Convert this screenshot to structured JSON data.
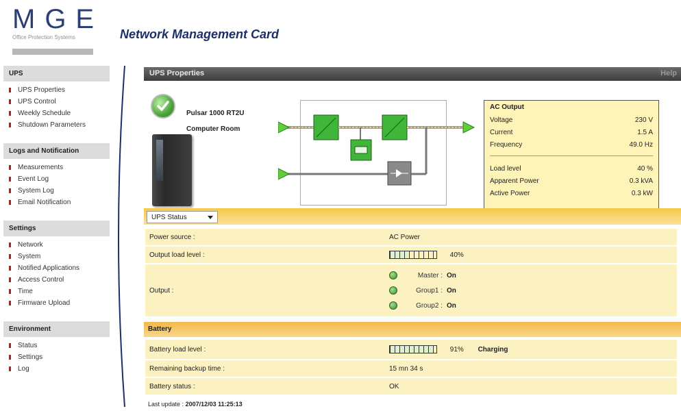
{
  "header": {
    "logo": "MGE",
    "logo_sub": "Office Protection Systems",
    "app_title": "Network Management Card"
  },
  "sidebar": {
    "sections": [
      {
        "title": "UPS",
        "items": [
          "UPS Properties",
          "UPS Control",
          "Weekly Schedule",
          "Shutdown Parameters"
        ]
      },
      {
        "title": "Logs and Notification",
        "items": [
          "Measurements",
          "Event Log",
          "System Log",
          "Email Notification"
        ]
      },
      {
        "title": "Settings",
        "items": [
          "Network",
          "System",
          "Notified Applications",
          "Access Control",
          "Time",
          "Firmware Upload"
        ]
      },
      {
        "title": "Environment",
        "items": [
          "Status",
          "Settings",
          "Log"
        ]
      }
    ]
  },
  "props": {
    "title": "UPS Properties",
    "help": "Help",
    "model": "Pulsar 1000 RT2U",
    "location": "Computer Room"
  },
  "ac_output": {
    "title": "AC Output",
    "rows1": [
      {
        "label": "Voltage",
        "value": "230 V"
      },
      {
        "label": "Current",
        "value": "1.5 A"
      },
      {
        "label": "Frequency",
        "value": "49.0 Hz"
      }
    ],
    "rows2": [
      {
        "label": "Load level",
        "value": "40 %"
      },
      {
        "label": "Apparent Power",
        "value": "0.3 kVA"
      },
      {
        "label": "Active Power",
        "value": "0.3 kW"
      }
    ]
  },
  "status": {
    "select_value": "UPS Status",
    "power_source_label": "Power source :",
    "power_source_value": "AC Power",
    "output_load_label": "Output load level :",
    "output_load_pct": "40%",
    "output_load_fraction": 0.4,
    "output_label": "Output :",
    "outputs": [
      {
        "name": "Master :",
        "state": "On"
      },
      {
        "name": "Group1 :",
        "state": "On"
      },
      {
        "name": "Group2 :",
        "state": "On"
      }
    ]
  },
  "battery": {
    "header": "Battery",
    "load_label": "Battery load level :",
    "load_pct": "91%",
    "load_fraction": 0.91,
    "charging": "Charging",
    "remaining_label": "Remaining backup time :",
    "remaining_value": "15 mn 34 s",
    "status_label": "Battery status :",
    "status_value": "OK"
  },
  "footer": {
    "last_update_label": "Last update :",
    "last_update_value": "2007/12/03 11:25:13"
  },
  "colors": {
    "accent": "#f5c84a",
    "title_blue": "#1e2e6a",
    "ok_green": "#4ca53a",
    "bullet_red": "#b32020"
  }
}
